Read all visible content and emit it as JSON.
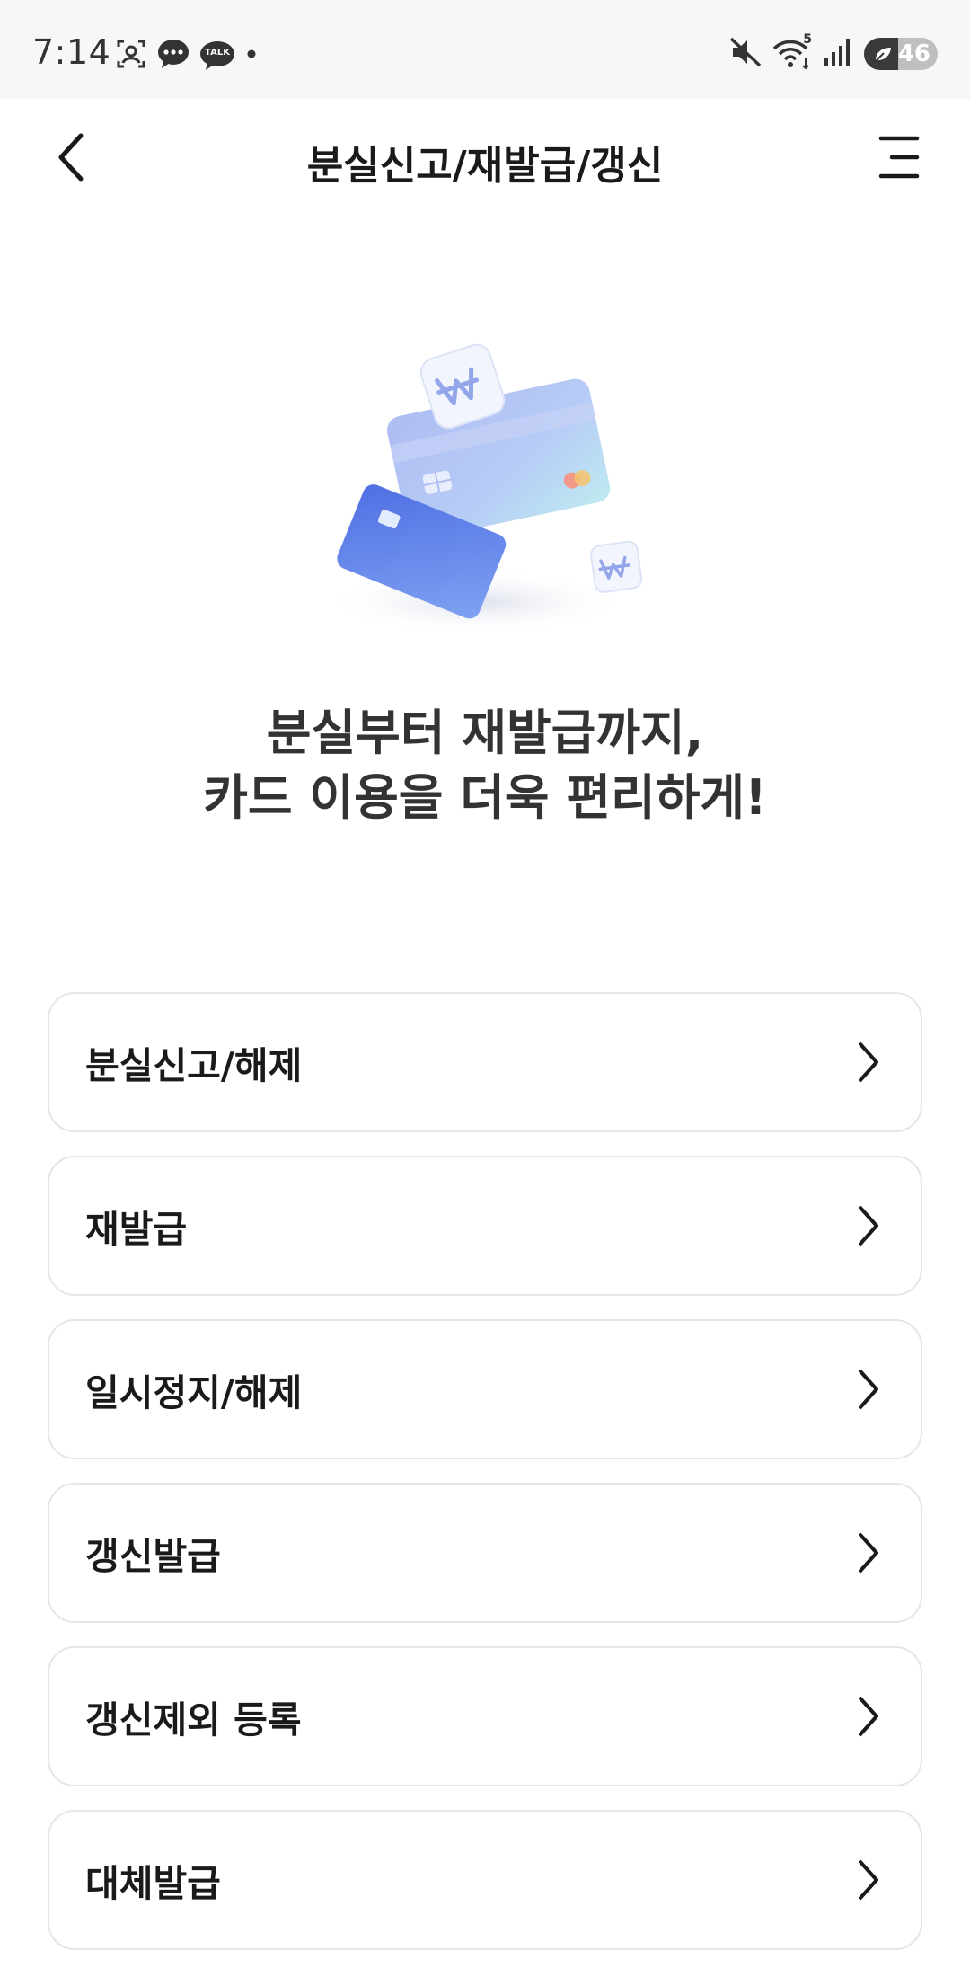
{
  "status_bar": {
    "time": "7:14",
    "battery_level": "46",
    "battery_fraction": 0.46,
    "left_icons": [
      "screenshot-icon",
      "chat-bubble-icon",
      "kakaotalk-icon",
      "dot-icon"
    ],
    "talk_label": "TALK",
    "right_icons": [
      "mute-icon",
      "wifi-icon",
      "signal-icon",
      "battery-icon"
    ],
    "wifi_badge": "5"
  },
  "header": {
    "title": "분실신고/재발급/갱신",
    "back_icon": "chevron-left-icon",
    "menu_icon": "hamburger-menu-icon"
  },
  "hero": {
    "line1": "분실부터 재발급까지,",
    "line2": "카드 이용을 더욱 편리하게!",
    "illustration": "cards-illustration"
  },
  "menu": {
    "items": [
      {
        "label": "분실신고/해제"
      },
      {
        "label": "재발급"
      },
      {
        "label": "일시정지/해제"
      },
      {
        "label": "갱신발급"
      },
      {
        "label": "갱신제외 등록"
      },
      {
        "label": "대체발급"
      }
    ]
  },
  "colors": {
    "text_primary": "#1a1a1a",
    "border": "#e6e6e6",
    "card_blue": "#5b7fe6",
    "card_light": "#b9c6f5"
  }
}
